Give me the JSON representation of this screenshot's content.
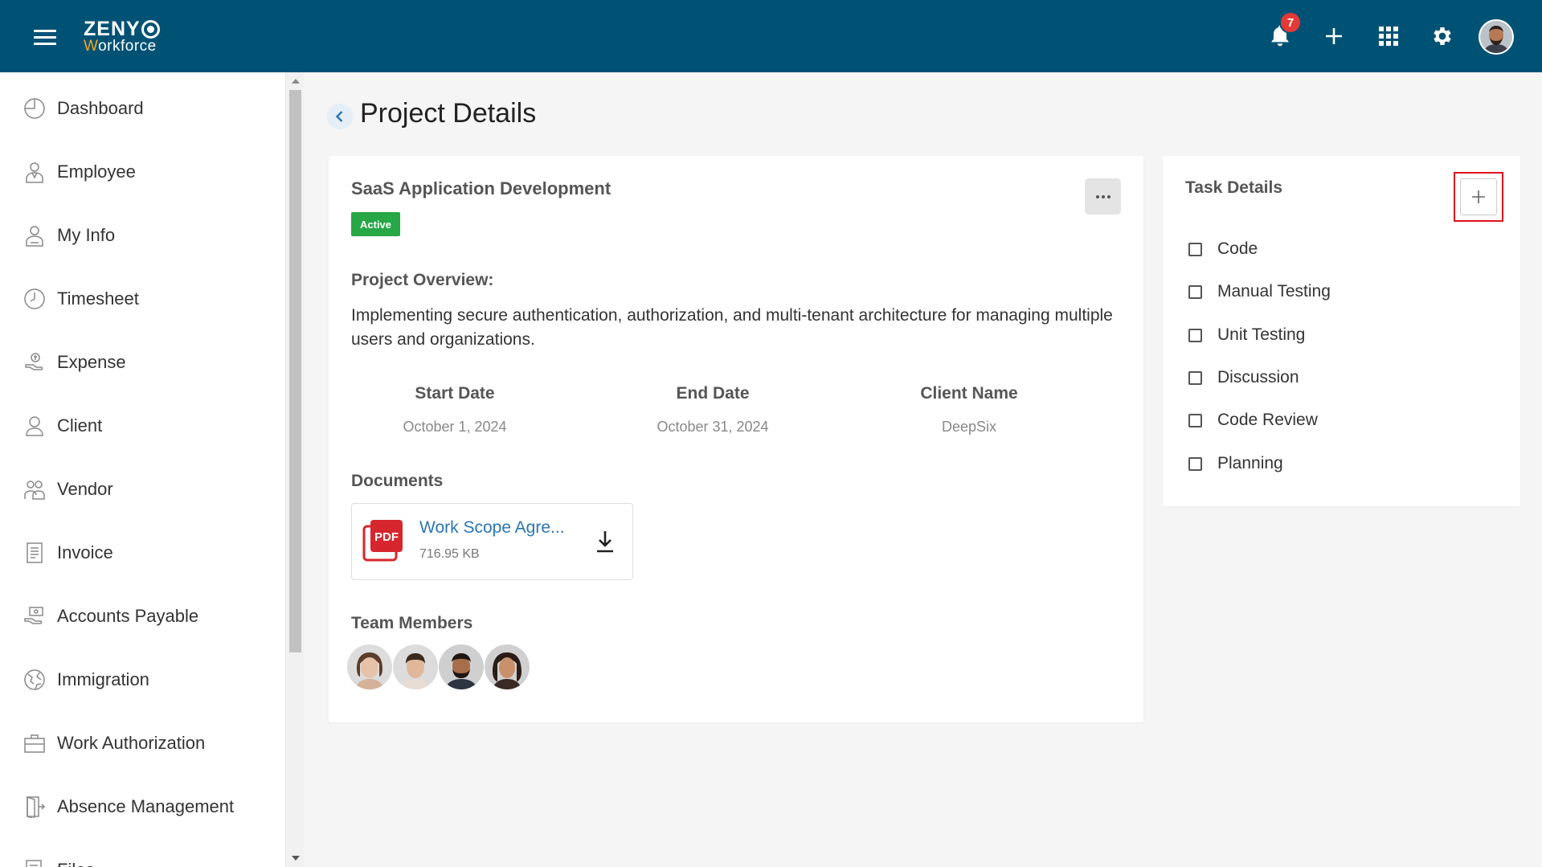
{
  "app": {
    "logo_top": "ZENY",
    "logo_sub_first": "W",
    "logo_sub_rest": "orkforce",
    "notification_count": "7",
    "add_label": "+"
  },
  "sidebar": {
    "items": [
      {
        "label": "Dashboard",
        "icon": "dashboard-icon"
      },
      {
        "label": "Employee",
        "icon": "employee-icon"
      },
      {
        "label": "My Info",
        "icon": "my-info-icon"
      },
      {
        "label": "Timesheet",
        "icon": "clock-icon"
      },
      {
        "label": "Expense",
        "icon": "expense-icon"
      },
      {
        "label": "Client",
        "icon": "client-icon"
      },
      {
        "label": "Vendor",
        "icon": "vendor-icon"
      },
      {
        "label": "Invoice",
        "icon": "invoice-icon"
      },
      {
        "label": "Accounts Payable",
        "icon": "accounts-payable-icon"
      },
      {
        "label": "Immigration",
        "icon": "globe-icon"
      },
      {
        "label": "Work Authorization",
        "icon": "briefcase-icon"
      },
      {
        "label": "Absence Management",
        "icon": "door-icon"
      },
      {
        "label": "Files",
        "icon": "files-icon"
      }
    ]
  },
  "page": {
    "title": "Project Details"
  },
  "project": {
    "name": "SaaS Application Development",
    "status": "Active",
    "overview_label": "Project Overview:",
    "overview_text": "Implementing secure authentication, authorization, and multi-tenant architecture for managing multiple users and organizations.",
    "start_date_label": "Start Date",
    "start_date": "October 1, 2024",
    "end_date_label": "End Date",
    "end_date": "October 31, 2024",
    "client_label": "Client Name",
    "client": "DeepSix",
    "documents_label": "Documents",
    "document": {
      "name": "Work Scope Agre...",
      "size": "716.95 KB",
      "type_label": "PDF"
    },
    "team_label": "Team Members",
    "team_count": 4
  },
  "tasks": {
    "title": "Task Details",
    "add_label": "+",
    "items": [
      "Code",
      "Manual Testing",
      "Unit Testing",
      "Discussion",
      "Code Review",
      "Planning"
    ]
  },
  "colors": {
    "header": "#005275",
    "active_badge": "#27a745",
    "notification_badge": "#e53935",
    "link": "#2a75b3",
    "highlight_border": "#e0121b"
  }
}
